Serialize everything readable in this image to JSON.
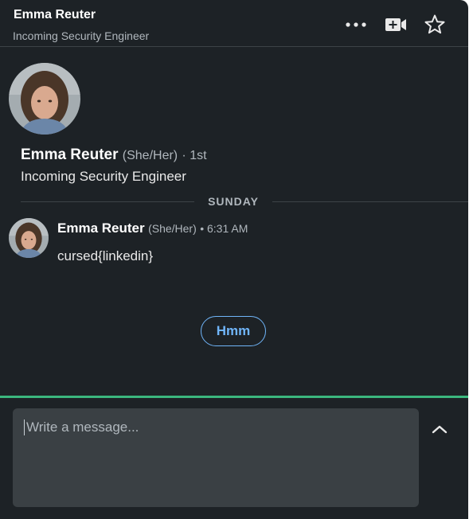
{
  "header": {
    "name": "Emma Reuter",
    "subtitle": "Incoming Security Engineer",
    "icons": [
      "more-icon",
      "video-add-icon",
      "star-icon"
    ]
  },
  "profile": {
    "name": "Emma Reuter",
    "pronouns": "(She/Her)",
    "degree": "· 1st",
    "headline": "Incoming Security Engineer"
  },
  "day_divider": "SUNDAY",
  "message": {
    "sender": "Emma Reuter",
    "pronouns": "(She/Her)",
    "time": "• 6:31 AM",
    "text": "cursed{linkedin}"
  },
  "suggested_reply": "Hmm",
  "compose": {
    "placeholder": "Write a message..."
  },
  "colors": {
    "background": "#1d2226",
    "accent_green": "#3bb77e",
    "link_blue": "#70b5f9",
    "input_bg": "#3a4044"
  }
}
